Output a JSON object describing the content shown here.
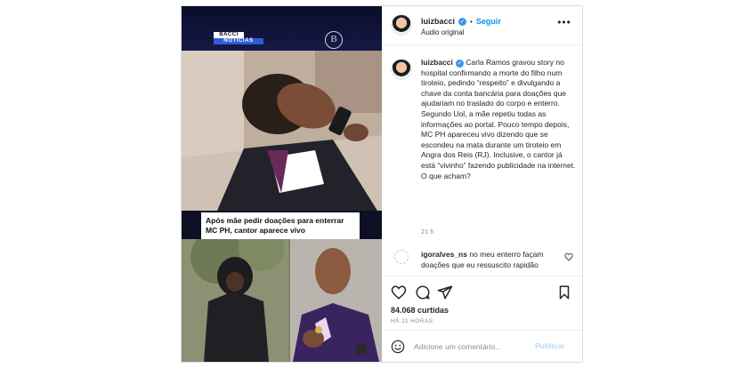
{
  "media": {
    "logo_top": "BACCI",
    "logo_bottom": "NOTICIAS",
    "seal_letter": "B",
    "overlay_text": "Após mãe pedir doações para enterrar MC PH, cantor aparece vivo"
  },
  "header": {
    "username": "luizbacci",
    "separator": "•",
    "follow_label": "Seguir",
    "audio_label": "Áudio original",
    "more_icon": "more-horizontal-icon"
  },
  "caption": {
    "username": "luizbacci",
    "text": "Carla Ramos gravou story no hospital confirmando a morte do filho num tiroteio, pedindo “respeito” e divulgando a chave da conta bancária para doações que ajudariam no traslado do corpo e enterro. Segundo Uol, a mãe repetiu todas as informações ao portal. Pouco tempo depois, MC PH apareceu vivo dizendo que se escondeu na mata durante um tiroteio em Angra dos Reis (RJ). Inclusive, o cantor já está “vivinho” fazendo publicidade na internet. O que acham?",
    "time": "21 h"
  },
  "comments": [
    {
      "username": "igoralves_ns",
      "text": "no meu enterro façam doações que eu ressuscito rapidão"
    }
  ],
  "actions": {
    "likes": "84.068 curtidas",
    "posted_ago": "HÁ 21 HORAS"
  },
  "add_comment": {
    "placeholder": "Adicione um comentário...",
    "publish_label": "Publicar"
  },
  "colors": {
    "accent_blue": "#0095f6",
    "verified_blue": "#3897f0",
    "muted_text": "#8e8e8e",
    "publish_disabled": "#b3dbff"
  }
}
